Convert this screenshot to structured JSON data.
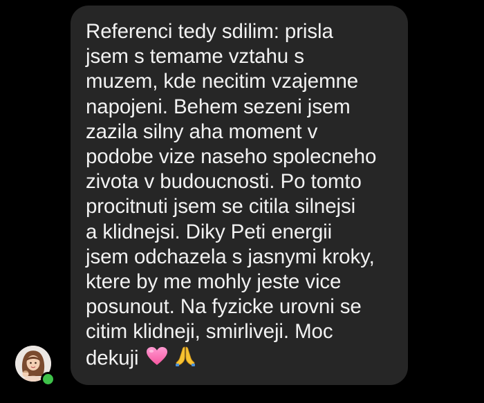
{
  "message": {
    "lines": [
      "Referenci tedy sdilim: prisla",
      "jsem s temame vztahu s",
      "muzem, kde necitim vzajemne",
      "napojeni. Behem sezeni jsem",
      "zazila silny aha moment v",
      "podobe vize naseho spolecneho",
      "zivota v budoucnosti. Po tomto",
      "procitnuti jsem se citila silnejsi",
      "a klidnejsi. Diky Peti energii",
      "jsem odchazela s jasnymi kroky,",
      "ktere by me mohly jeste vice",
      "posunout. Na fyzicke urovni se",
      "citim klidneji, smirliveji. Moc",
      "dekuji"
    ],
    "emojis": [
      "pink-heart-icon",
      "folded-hands-icon"
    ]
  },
  "sender": {
    "avatar_icon": "user-avatar-illustration",
    "status": "online",
    "status_color": "#3ec24a"
  },
  "colors": {
    "background": "#000000",
    "bubble": "#262626",
    "text": "#f2f2f2",
    "heart": "#ff6fb5",
    "hands": "#f6c232"
  }
}
